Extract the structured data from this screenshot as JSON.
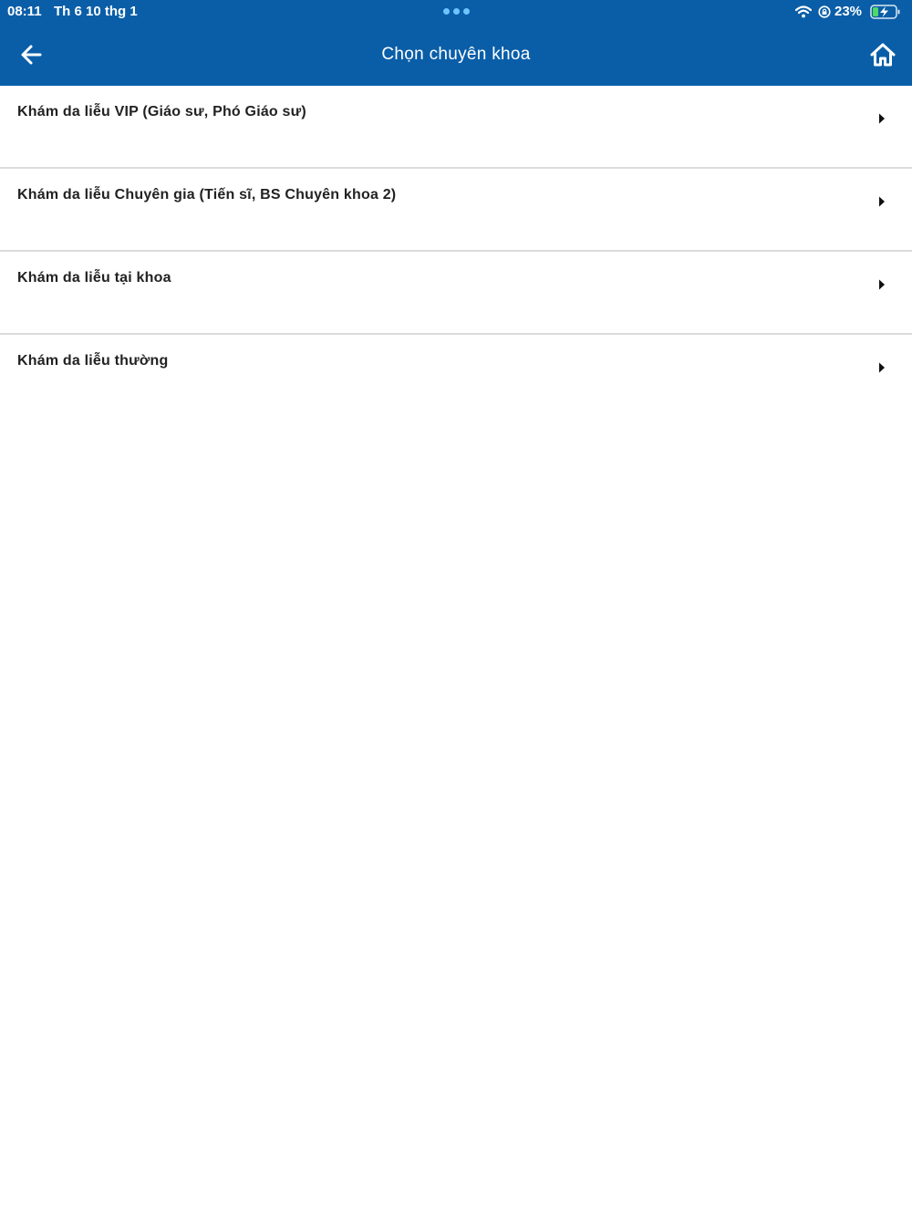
{
  "status_bar": {
    "time": "08:11",
    "date": "Th 6 10 thg 1",
    "battery": "23%",
    "icons": [
      "wifi-icon",
      "orientation-lock-icon",
      "battery-charging-icon"
    ]
  },
  "header": {
    "title": "Chọn chuyên khoa",
    "back_icon": "arrow-left-icon",
    "home_icon": "home-icon",
    "background_color": "#0a5ea8"
  },
  "specialties": [
    {
      "label": "Khám da liễu VIP (Giáo sư, Phó Giáo sư)"
    },
    {
      "label": "Khám da liễu Chuyên gia (Tiến sĩ, BS Chuyên khoa 2)"
    },
    {
      "label": "Khám da liễu tại khoa"
    },
    {
      "label": "Khám da liễu thường"
    }
  ]
}
